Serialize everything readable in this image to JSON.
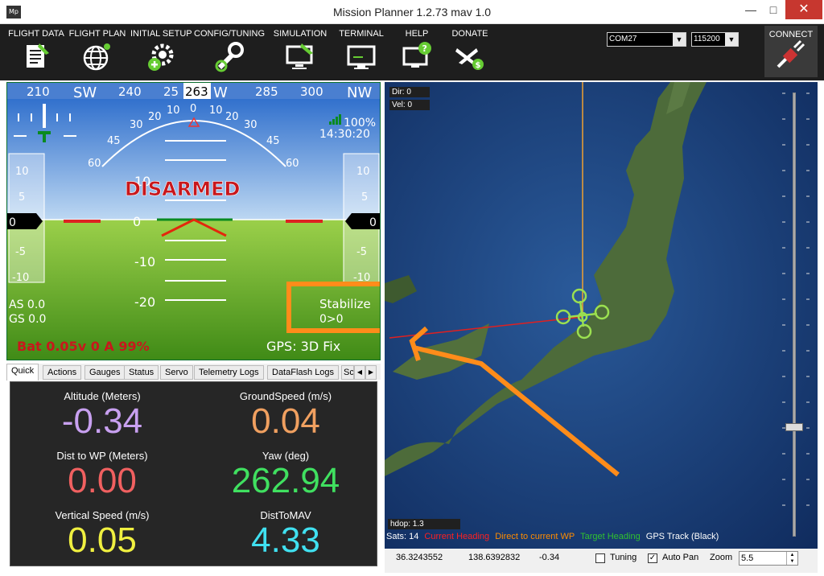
{
  "window": {
    "title": "Mission Planner 1.2.73 mav 1.0",
    "app_icon": "Mp"
  },
  "menu": [
    {
      "label": "FLIGHT DATA",
      "icon": "flight-data-icon"
    },
    {
      "label": "FLIGHT PLAN",
      "icon": "globe-icon"
    },
    {
      "label": "INITIAL SETUP",
      "icon": "gear-plus-icon"
    },
    {
      "label": "CONFIG/TUNING",
      "icon": "wrench-icon"
    },
    {
      "label": "SIMULATION",
      "icon": "monitor-plane-icon"
    },
    {
      "label": "TERMINAL",
      "icon": "terminal-icon"
    },
    {
      "label": "HELP",
      "icon": "help-monitor-icon"
    },
    {
      "label": "DONATE",
      "icon": "donate-plane-icon"
    }
  ],
  "connection": {
    "port": "COM27",
    "baud": "115200",
    "connect_label": "CONNECT"
  },
  "hud": {
    "heading_ticks": [
      "210",
      "SW",
      "240",
      "25",
      "263",
      "W",
      "285",
      "300",
      "NW"
    ],
    "roll_ticks": [
      "60",
      "45",
      "30",
      "20",
      "10",
      "0",
      "10",
      "20",
      "30",
      "45",
      "60"
    ],
    "pitch_ticks": [
      "10",
      "0",
      "-10",
      "-20"
    ],
    "speed_ticks": [
      "10",
      "5",
      "0",
      "-5",
      "-10"
    ],
    "alt_ticks": [
      "10",
      "5",
      "0",
      "-5",
      "-10"
    ],
    "speed_value": "0",
    "alt_value": "0",
    "armed_status": "DISARMED",
    "signal": "100%",
    "time": "14:30:20",
    "airspeed": "AS 0.0",
    "groundspeed": "GS 0.0",
    "mode": "Stabilize",
    "wp": "0>0",
    "battery": "Bat 0.05v 0 A 99%",
    "gps": "GPS: 3D Fix"
  },
  "tabs": [
    "Quick",
    "Actions",
    "Gauges",
    "Status",
    "Servo",
    "Telemetry Logs",
    "DataFlash Logs",
    "Sc"
  ],
  "quick": [
    {
      "label": "Altitude (Meters)",
      "value": "-0.34",
      "color": "#c8a0f0"
    },
    {
      "label": "GroundSpeed (m/s)",
      "value": "0.04",
      "color": "#f0a060"
    },
    {
      "label": "Dist to WP (Meters)",
      "value": "0.00",
      "color": "#f06060"
    },
    {
      "label": "Yaw (deg)",
      "value": "262.94",
      "color": "#40e060"
    },
    {
      "label": "Vertical Speed (m/s)",
      "value": "0.05",
      "color": "#f0f040"
    },
    {
      "label": "DistToMAV",
      "value": "4.33",
      "color": "#40e0f0"
    }
  ],
  "map": {
    "dir": "Dir: 0",
    "vel": "Vel: 0",
    "hdop": "hdop: 1.3",
    "legend": [
      {
        "text": "Sats: 14",
        "color": "#ffffff"
      },
      {
        "text": "Current Heading",
        "color": "#ff2020"
      },
      {
        "text": "Direct to current WP",
        "color": "#ff8c00"
      },
      {
        "text": "Target Heading",
        "color": "#30c030"
      },
      {
        "text": "GPS Track (Black)",
        "color": "#ffffff"
      }
    ]
  },
  "status": {
    "lat": "36.3243552",
    "lng": "138.6392832",
    "alt": "-0.34",
    "tuning_label": "Tuning",
    "tuning_checked": false,
    "autopan_label": "Auto Pan",
    "autopan_checked": true,
    "zoom_label": "Zoom",
    "zoom_value": "5.5"
  }
}
